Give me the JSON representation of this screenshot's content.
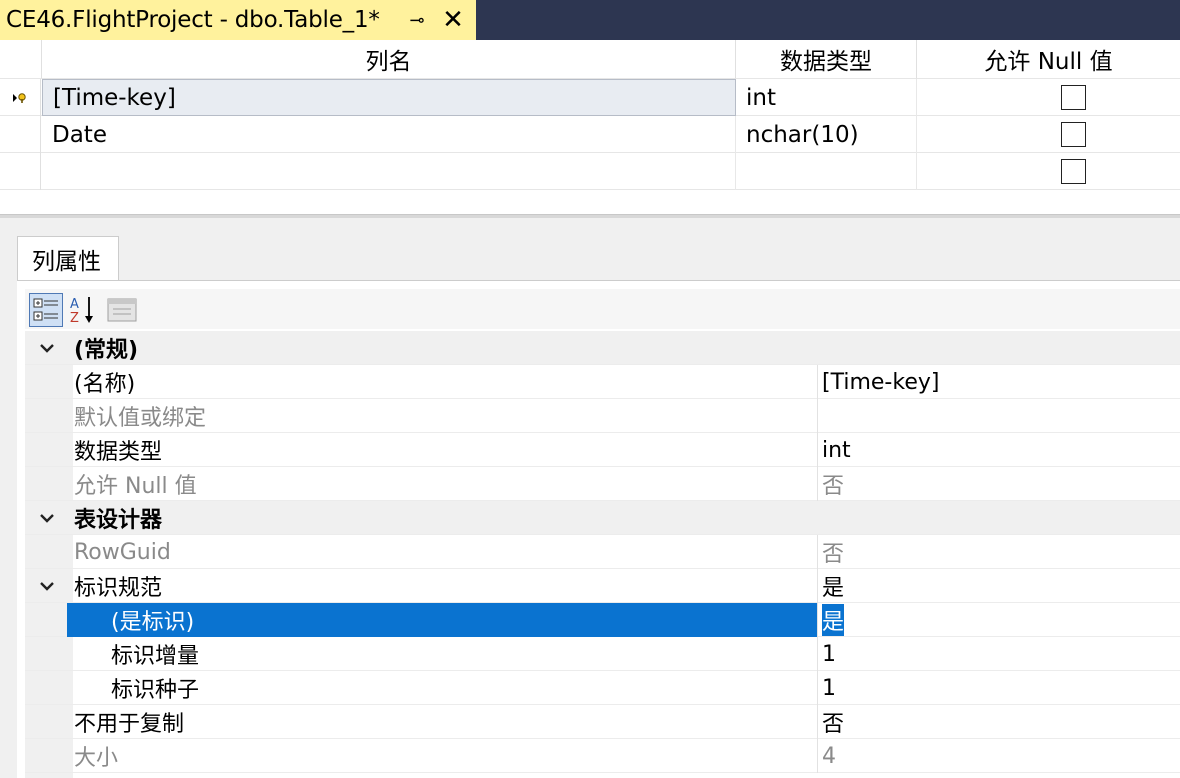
{
  "title_tab": {
    "title": "CE46.FlightProject - dbo.Table_1*",
    "pin_glyph": "⊸",
    "close_glyph": "✕"
  },
  "grid": {
    "headers": [
      "列名",
      "数据类型",
      "允许 Null 值"
    ],
    "rows": [
      {
        "name": "[Time-key]",
        "type": "int",
        "allow_null": false
      },
      {
        "name": "Date",
        "type": "nchar(10)",
        "allow_null": false
      },
      {
        "name": "",
        "type": "",
        "allow_null": false
      }
    ]
  },
  "properties_tab": "列属性",
  "properties": {
    "general_category": "(常规)",
    "name_label": "(名称)",
    "name_value": "[Time-key]",
    "default_label": "默认值或绑定",
    "default_value": "",
    "datatype_label": "数据类型",
    "datatype_value": "int",
    "allownull_label": "允许 Null 值",
    "allownull_value": "否",
    "designer_category": "表设计器",
    "rowguid_label": "RowGuid",
    "rowguid_value": "否",
    "identity_label": "标识规范",
    "identity_value": "是",
    "isidentity_label": "(是标识)",
    "isidentity_value": "是",
    "increment_label": "标识增量",
    "increment_value": "1",
    "seed_label": "标识种子",
    "seed_value": "1",
    "notrep_label": "不用于复制",
    "notrep_value": "否",
    "size_label": "大小",
    "size_value": "4"
  },
  "colors": {
    "titlebar": "#2d3651",
    "active_tab": "#fff29d",
    "selection": "#0a73d0"
  }
}
